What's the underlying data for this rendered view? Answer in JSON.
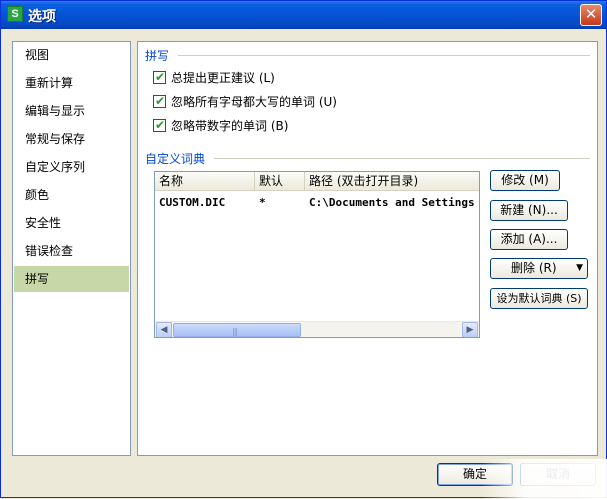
{
  "window": {
    "title": "选项",
    "icon_glyph": "S",
    "close_glyph": "✕"
  },
  "nav": {
    "items": [
      {
        "label": "视图"
      },
      {
        "label": "重新计算"
      },
      {
        "label": "编辑与显示"
      },
      {
        "label": "常规与保存"
      },
      {
        "label": "自定义序列"
      },
      {
        "label": "颜色"
      },
      {
        "label": "安全性"
      },
      {
        "label": "错误检查"
      },
      {
        "label": "拼写",
        "selected": true
      }
    ]
  },
  "spelling": {
    "group_title": "拼写",
    "options": [
      {
        "label": "总提出更正建议 (L)",
        "checked": true
      },
      {
        "label": "忽略所有字母都大写的单词 (U)",
        "checked": true
      },
      {
        "label": "忽略带数字的单词 (B)",
        "checked": true
      }
    ]
  },
  "dictionary": {
    "group_title": "自定义词典",
    "columns": [
      "名称",
      "默认",
      "路径 (双击打开目录)"
    ],
    "rows": [
      {
        "name": "CUSTOM.DIC",
        "default": "*",
        "path": "C:\\Documents and Settings"
      }
    ],
    "buttons": {
      "modify": "修改 (M)",
      "new": "新建 (N)...",
      "add": "添加 (A)...",
      "delete": "删除 (R)",
      "set_default": "设为默认词典 (S)"
    },
    "delete_arrow": "▼"
  },
  "scrollbar": {
    "left_arrow": "◀",
    "right_arrow": "▶",
    "grip": "|||"
  },
  "footer": {
    "ok": "确定",
    "cancel": "取消"
  },
  "colors": {
    "title_bar": "#0653d6",
    "group_title": "#0046d5",
    "selected_nav": "#c7d7a7",
    "check_tick": "#21a121"
  },
  "icons": {
    "check": "✔"
  }
}
